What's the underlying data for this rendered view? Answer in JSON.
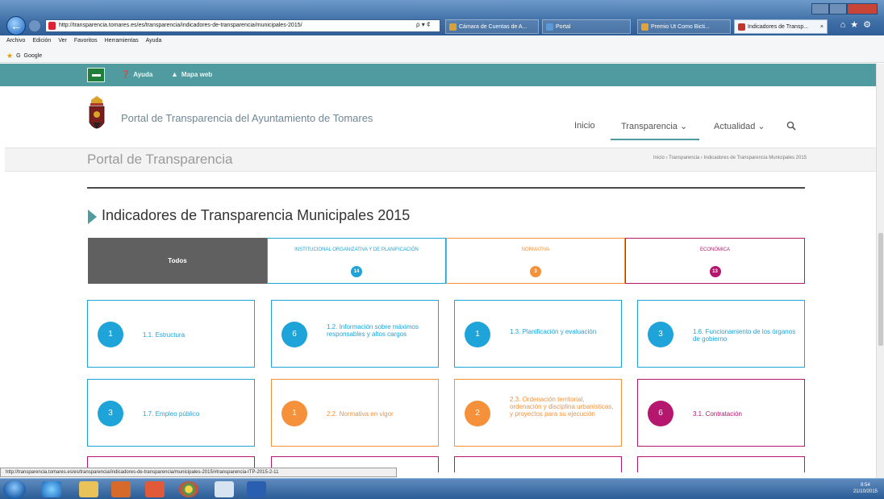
{
  "browser": {
    "url": "http://transparencia.tomares.es/es/transparencia/indicadores-de-transparencia/municipales-2015/",
    "address_tools": "ρ ▾ ¢",
    "tabs": [
      {
        "label": "Cámara de Cuentas de A...",
        "color": "#d5a23a"
      },
      {
        "label": "Portal",
        "color": "#5a9ad8"
      },
      {
        "label": "Premio Ut Como Bicti...",
        "color": "#e3a33b"
      },
      {
        "label": "Indicadores de Transp...",
        "color": "#c2342c",
        "close": "×"
      }
    ],
    "top_icons": "⌂★⚙",
    "menu": [
      "Archivo",
      "Edición",
      "Ver",
      "Favoritos",
      "Herramientas",
      "Ayuda"
    ],
    "favorites": "Google",
    "status_url": "http://transparencia.tomares.es/es/transparencia/indicadores-de-transparencia/municipales-2015/#transparencia-ITP-2015-2-11"
  },
  "site": {
    "topbar": {
      "help": "Ayuda",
      "help_icon": "question-circle-icon",
      "sitemap": "Mapa web",
      "sitemap_icon": "sitemap-icon",
      "accent_color": "#4f9ba0"
    },
    "portal_title": "Portal de Transparencia del Ayuntamiento de Tomares",
    "nav": {
      "inicio": "Inicio",
      "transparencia": "Transparencia ⌄",
      "actualidad": "Actualidad ⌄",
      "search_icon": "search-icon"
    },
    "subheader": {
      "title": "Portal de Transparencia",
      "breadcrumb": "Inicio  ›  Transparencia  ›  Indicadores de Transparencia Municipales 2015"
    }
  },
  "main": {
    "title": "Indicadores de Transparencia Municipales 2015",
    "categories": [
      {
        "label": "Todos",
        "count": "",
        "color": "#606060"
      },
      {
        "label": "INSTITUCIONAL ORGANIZATIVA Y DE PLANIFICACIÓN",
        "count": "14",
        "color": "#1ea4d8"
      },
      {
        "label": "NORMATIVA",
        "count": "3",
        "color": "#f5913a"
      },
      {
        "label": "ECONÓMICA",
        "count": "13",
        "color": "#b5176e"
      }
    ],
    "cards_row1": [
      {
        "count": "1",
        "label": "1.1. Estructura",
        "color": "#1ea4d8"
      },
      {
        "count": "6",
        "label": "1.2. Información sobre máximos responsables y altos cargos",
        "color": "#1ea4d8"
      },
      {
        "count": "1",
        "label": "1.3. Planificación y evaluación",
        "color": "#1ea4d8"
      },
      {
        "count": "3",
        "label": "1.6. Funcionamiento de los órganos de gobierno",
        "color": "#1ea4d8"
      }
    ],
    "cards_row2": [
      {
        "count": "3",
        "label": "1.7. Empleo público",
        "color": "#1ea4d8"
      },
      {
        "count": "1",
        "label": "2.2. Normativa en vigor",
        "color": "#f5913a"
      },
      {
        "count": "2",
        "label": "2.3. Ordenación territorial, ordenación y disciplina urbanísticas, y proyectos para su ejecución",
        "color": "#f5913a"
      },
      {
        "count": "6",
        "label": "3.1. Contratación",
        "color": "#b5176e"
      }
    ]
  },
  "taskbar": {
    "clock_time": "8:54",
    "clock_date": "21/10/2015"
  }
}
